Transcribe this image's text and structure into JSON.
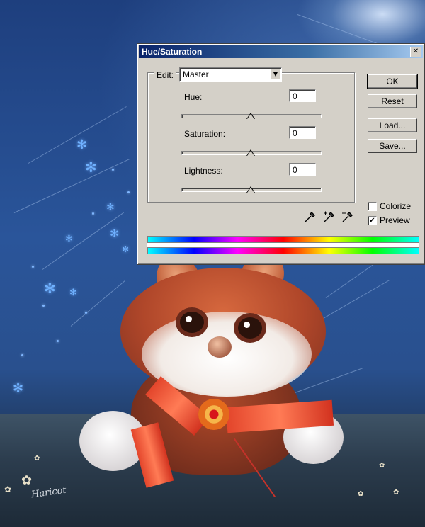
{
  "dialog": {
    "title": "Hue/Saturation",
    "edit_label": "Edit:",
    "edit_value": "Master",
    "fields": [
      {
        "label": "Hue:",
        "value": "0",
        "slider_level": 0.5
      },
      {
        "label": "Saturation:",
        "value": "0",
        "slider_level": 0.5
      },
      {
        "label": "Lightness:",
        "value": "0",
        "slider_level": 0.5
      }
    ],
    "buttons": {
      "ok": "OK",
      "reset": "Reset",
      "load": "Load...",
      "save": "Save..."
    },
    "colorize": {
      "label": "Colorize",
      "checked": false
    },
    "preview": {
      "label": "Preview",
      "checked": true,
      "mark": "✔"
    },
    "close_glyph": "✕",
    "dropdown_glyph": "▼"
  },
  "background": {
    "signature": "Haricot"
  },
  "colors": {
    "titlebar_start": "#0a246a",
    "titlebar_end": "#a6caf0",
    "dialog_face": "#d4d0c8",
    "sky": "#1e3f7e",
    "ribbon": "#e3452b"
  },
  "icons": [
    "close-icon",
    "dropdown-arrow-icon",
    "eyedropper-icon",
    "eyedropper-plus-icon",
    "eyedropper-minus-icon"
  ]
}
